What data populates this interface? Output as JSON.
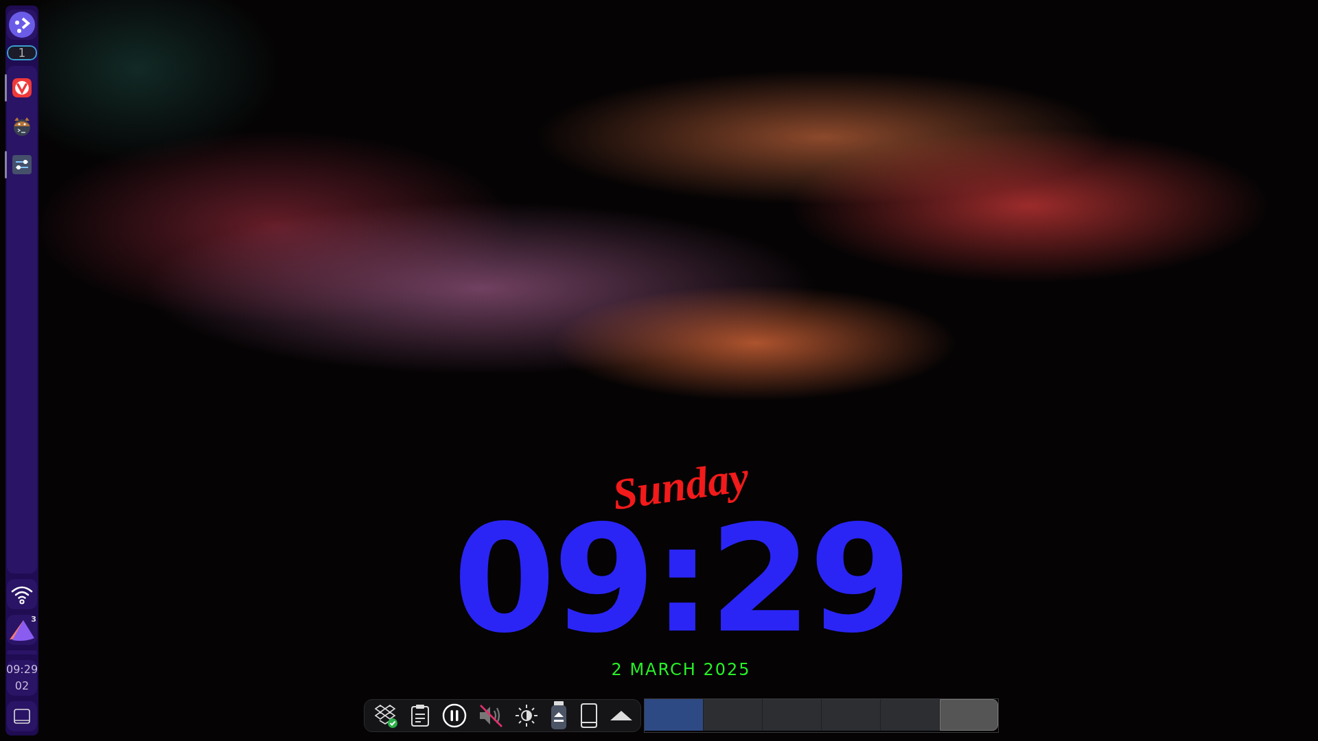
{
  "panel": {
    "workspace": "1",
    "tasks": [
      {
        "kind": "browser",
        "running": true
      },
      {
        "kind": "terminal",
        "running": false
      },
      {
        "kind": "settings",
        "running": true
      }
    ],
    "tray": [
      {
        "kind": "wifi"
      },
      {
        "kind": "updates",
        "badge": "3"
      }
    ],
    "clock": {
      "time": "09:29",
      "day": "02"
    }
  },
  "desktop_clock": {
    "time": "09:29",
    "weekday": "Sunday",
    "date": "2 MARCH 2025"
  },
  "system_tray": [
    {
      "kind": "dropbox"
    },
    {
      "kind": "clipboard"
    },
    {
      "kind": "media"
    },
    {
      "kind": "volume",
      "muted": true
    },
    {
      "kind": "brightness"
    },
    {
      "kind": "usb"
    },
    {
      "kind": "phone"
    },
    {
      "kind": "expand"
    }
  ],
  "pager": [
    {
      "selected": true,
      "highlighted": false
    },
    {
      "selected": false,
      "highlighted": false
    },
    {
      "selected": false,
      "highlighted": false
    },
    {
      "selected": false,
      "highlighted": false
    },
    {
      "selected": false,
      "highlighted": false
    },
    {
      "selected": false,
      "highlighted": true
    }
  ]
}
